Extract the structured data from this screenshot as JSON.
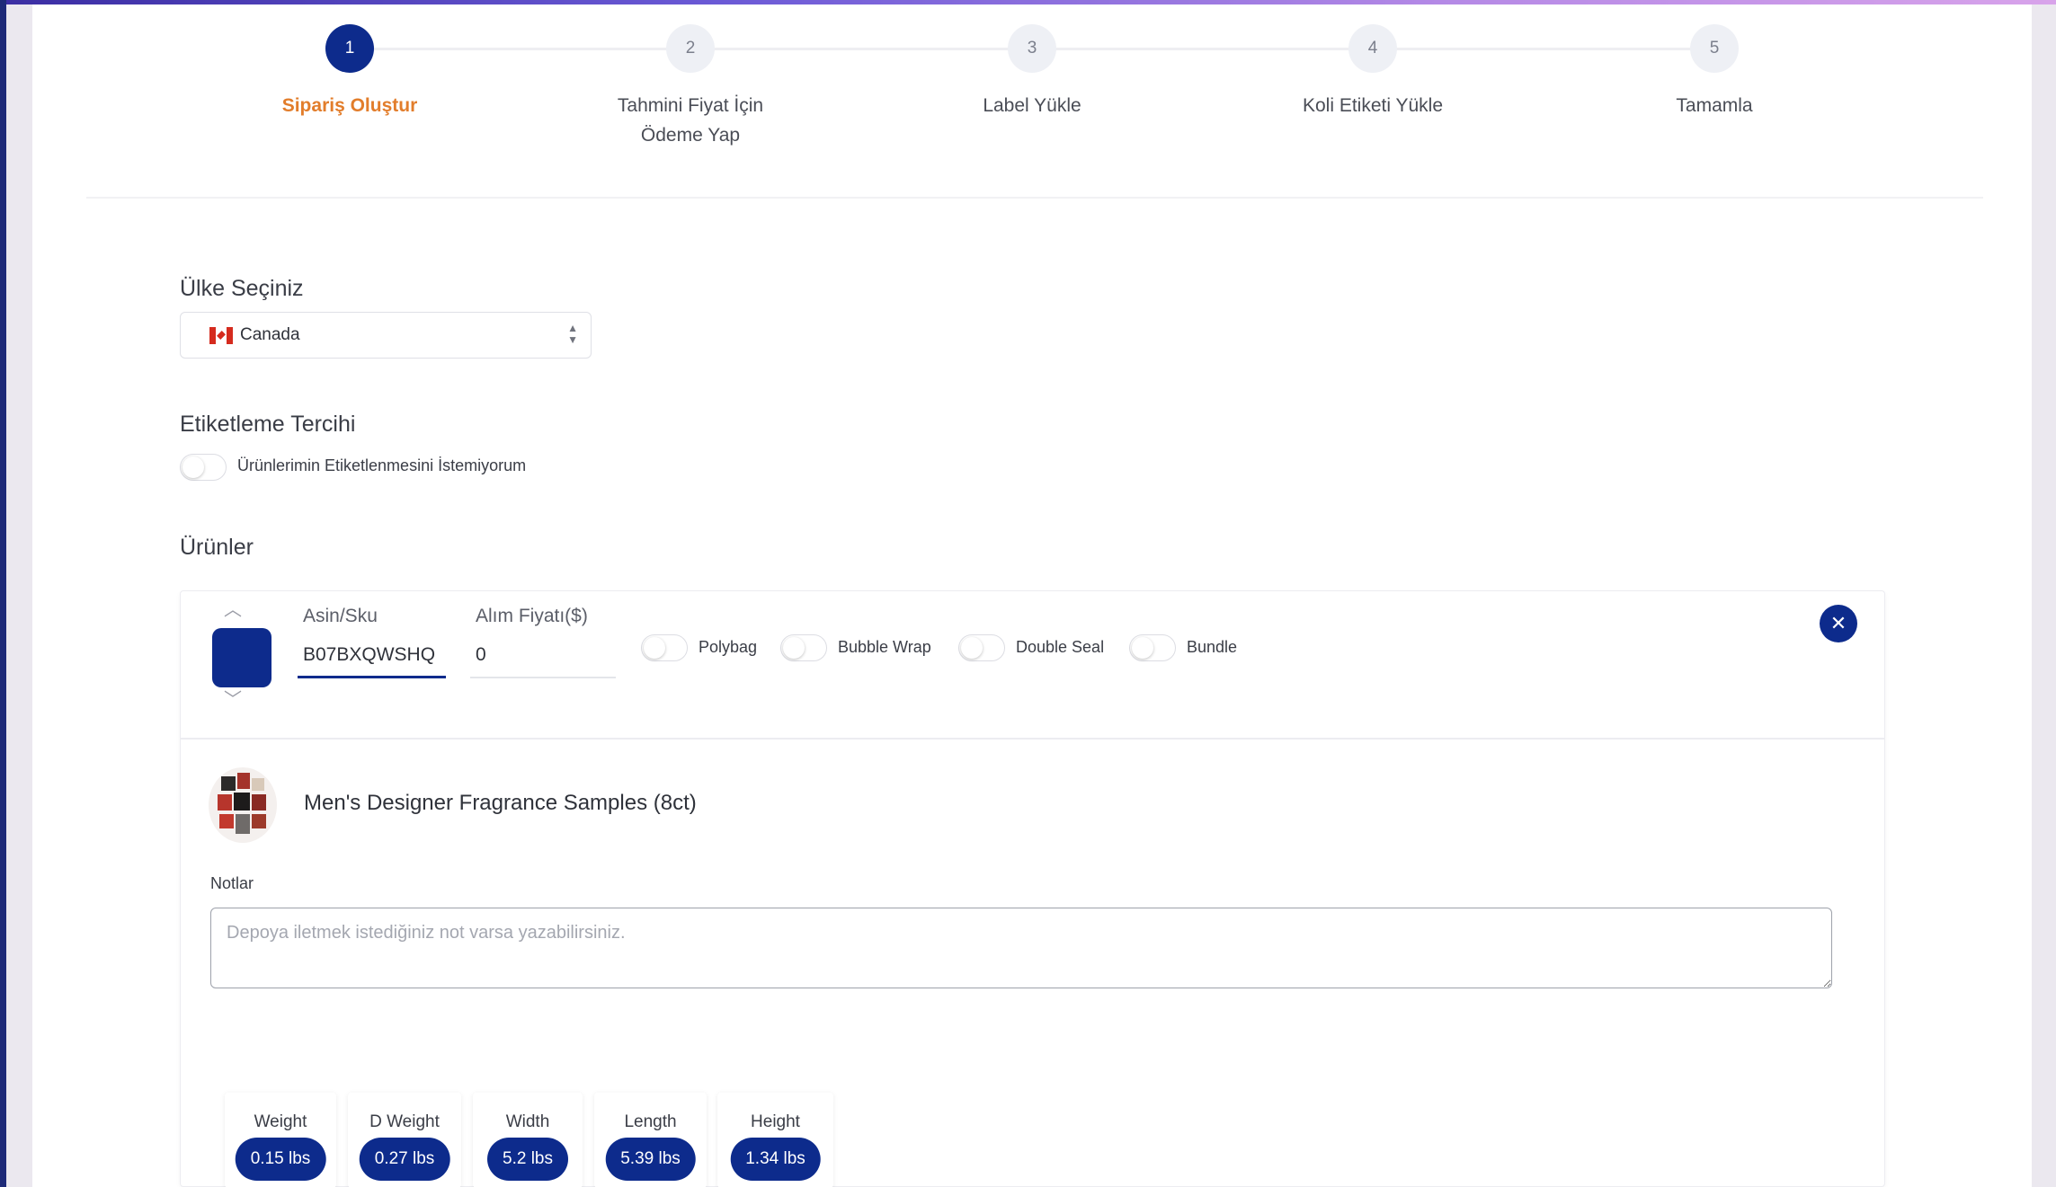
{
  "steps": [
    {
      "number": "1",
      "label": "Sipariş Oluştur",
      "active": true
    },
    {
      "number": "2",
      "label": "Tahmini Fiyat İçin Ödeme Yap",
      "line1": "Tahmini Fiyat İçin",
      "line2": "Ödeme Yap"
    },
    {
      "number": "3",
      "label": "Label Yükle"
    },
    {
      "number": "4",
      "label": "Koli Etiketi Yükle"
    },
    {
      "number": "5",
      "label": "Tamamla"
    }
  ],
  "country": {
    "title": "Ülke Seçiniz",
    "selected": "Canada",
    "flag_icon": "canada-flag-icon"
  },
  "labeling": {
    "title": "Etiketleme Tercihi",
    "toggle_label": "Ürünlerimin Etiketlenmesini İstemiyorum",
    "enabled": false
  },
  "products": {
    "title": "Ürünler",
    "item": {
      "color": "#0d2b8c",
      "asin_label": "Asin/Sku",
      "asin_value": "B07BXQWSHQ",
      "price_label": "Alım Fiyatı($)",
      "price_value": "0",
      "options": [
        {
          "label": "Polybag",
          "enabled": false
        },
        {
          "label": "Bubble Wrap",
          "enabled": false
        },
        {
          "label": "Double Seal",
          "enabled": false
        },
        {
          "label": "Bundle",
          "enabled": false
        }
      ],
      "remove_icon": "close-icon",
      "name": "Men's Designer Fragrance Samples (8ct)",
      "notes_label": "Notlar",
      "notes_placeholder": "Depoya iletmek istediğiniz not varsa yazabilirsiniz.",
      "metrics": [
        {
          "label": "Weight",
          "value": "0.15 lbs"
        },
        {
          "label": "D Weight",
          "value": "0.27 lbs"
        },
        {
          "label": "Width",
          "value": "5.2 lbs"
        },
        {
          "label": "Length",
          "value": "5.39 lbs"
        },
        {
          "label": "Height",
          "value": "1.34 lbs"
        }
      ]
    }
  },
  "colors": {
    "primary": "#0d2b8c",
    "active_step_label": "#e27d2b"
  }
}
